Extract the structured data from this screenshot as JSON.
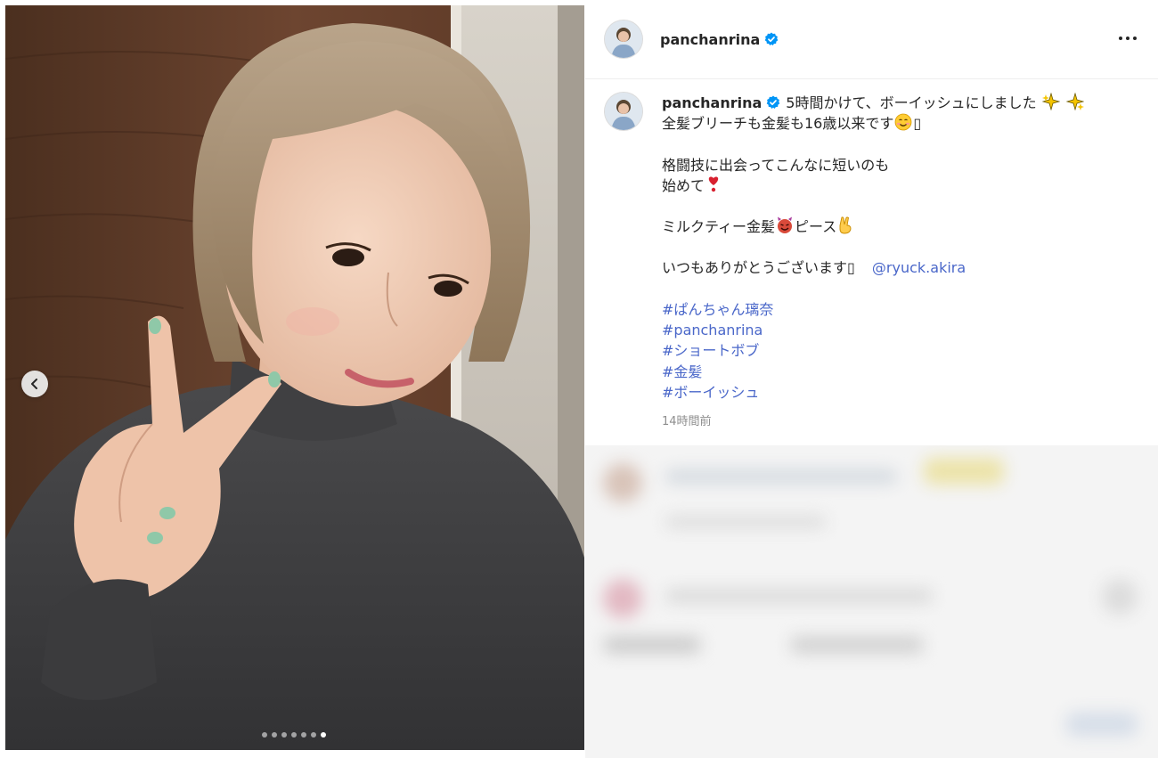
{
  "post": {
    "username": "panchanrina",
    "verified": true,
    "more_label": "•••",
    "caption": {
      "line1": "5時間かけて、ボーイッシュにしました",
      "line2": "全髪ブリーチも金髪も16歳以来です",
      "line3": "格闘技に出会ってこんなに短いのも",
      "line4": "始めて",
      "line5_a": "ミルクティー金髪",
      "line5_b": "ピース",
      "line6": "いつもありがとうございます",
      "mention": "@ryuck.akira",
      "placeholder_glyph": "▯",
      "hashtags": [
        "#ぱんちゃん璃奈",
        "#panchanrina",
        "#ショートボブ",
        "#金髪",
        "#ボーイッシュ"
      ]
    },
    "timestamp": "14時間前"
  },
  "carousel": {
    "dot_count": 7,
    "active_index": 6
  },
  "icons": {
    "prev": "chevron-left-icon",
    "verified": "verified-badge-icon",
    "more": "more-options-icon",
    "sparkles": "sparkles-emoji",
    "smile": "smiling-face-emoji",
    "heart": "heart-exclamation-emoji",
    "devil": "smiling-devil-emoji",
    "peace": "victory-hand-emoji"
  },
  "colors": {
    "link": "#4a67c9",
    "verified": "#0095f6",
    "muted": "#8e8e8e",
    "text": "#262626"
  }
}
